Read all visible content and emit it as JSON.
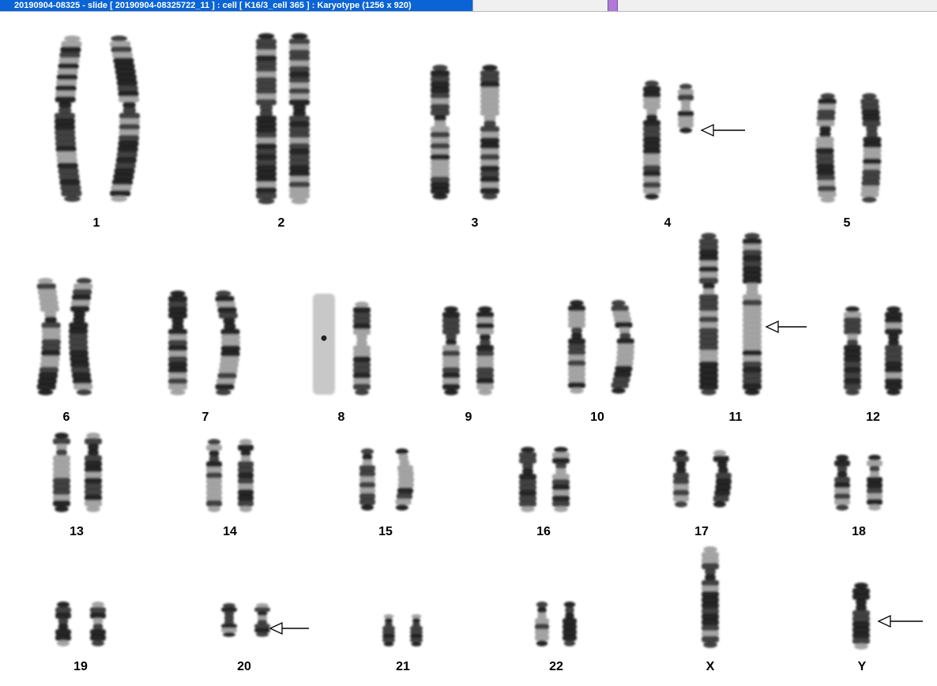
{
  "window": {
    "title": "20190904-08325 - slide [  20190904-08325722_11 ] : cell [ K16/3_cell 365 ] : Karyotype  (1256 x 920)"
  },
  "karyotype": {
    "chromosome_labels": [
      "1",
      "2",
      "3",
      "4",
      "5",
      "6",
      "7",
      "8",
      "9",
      "10",
      "11",
      "12",
      "13",
      "14",
      "15",
      "16",
      "17",
      "18",
      "19",
      "20",
      "21",
      "22",
      "X",
      "Y"
    ],
    "abnormal_markers": [
      "4",
      "11",
      "20",
      "Y"
    ]
  },
  "colors": {
    "title_bar": "#0a64d6",
    "title_text": "#ffffff",
    "chromosome": "#2b2b2b",
    "band_dark": "#111111",
    "band_light": "#9a9a9a",
    "arrow": "#000000"
  }
}
